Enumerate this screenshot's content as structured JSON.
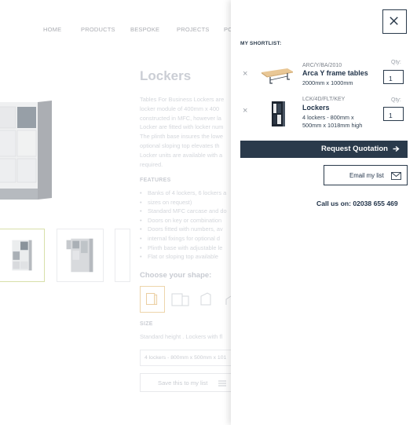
{
  "background_page": {
    "nav": [
      "HOME",
      "PRODUCTS",
      "BESPOKE",
      "PROJECTS",
      "PO"
    ],
    "title": "Lockers",
    "description": "Tables For Business Lockers are\nlocker module of 400mm x 400\nconstructed in MFC, however la\nLocker are fitted with locker num\nThe plinth base insures the lowe\noptional sloping top elevates th\nLocker units are available with a\nrequired.",
    "features_heading": "FEATURES",
    "features": [
      "Banks of 4 lockers, 6 lockers a",
      "sizes on request)",
      "Standard MFC carcase and do",
      "Doors on key or combination",
      "Doors fitted with numbers, av",
      "internal fixings for optional d",
      "Plinth base with adjustable le",
      "Flat or sloping top available"
    ],
    "shape_heading": "Choose your shape:",
    "size_heading": "SIZE",
    "size_description": "Standard height . Lockers with fl",
    "size_selected": "4 lockers - 800mm x 500mm x 101",
    "save_button": "Save this to my list"
  },
  "shortlist": {
    "heading": "MY SHORTLIST:",
    "items": [
      {
        "code": "ARC/Y/BA/2010",
        "name": "Arca Y frame tables",
        "spec": "2000mm x 1000mm",
        "qty_label": "Qty:",
        "qty": "1",
        "remove": "×",
        "image_icon": "table-thumbnail-icon"
      },
      {
        "code": "LCK/4D/FLT/KEY",
        "name": "Lockers",
        "spec": "4 lockers - 800mm x\n500mm x 1018mm high",
        "qty_label": "Qty:",
        "qty": "1",
        "remove": "×",
        "image_icon": "locker-thumbnail-icon"
      }
    ],
    "request_button": "Request Quotation",
    "email_button": "Email my list",
    "call_text": "Call us on: 02038 655 469"
  },
  "colors": {
    "navy": "#2a3a4b",
    "selected_thumb": "#c9d48a",
    "selected_shape": "#e6c58b"
  }
}
